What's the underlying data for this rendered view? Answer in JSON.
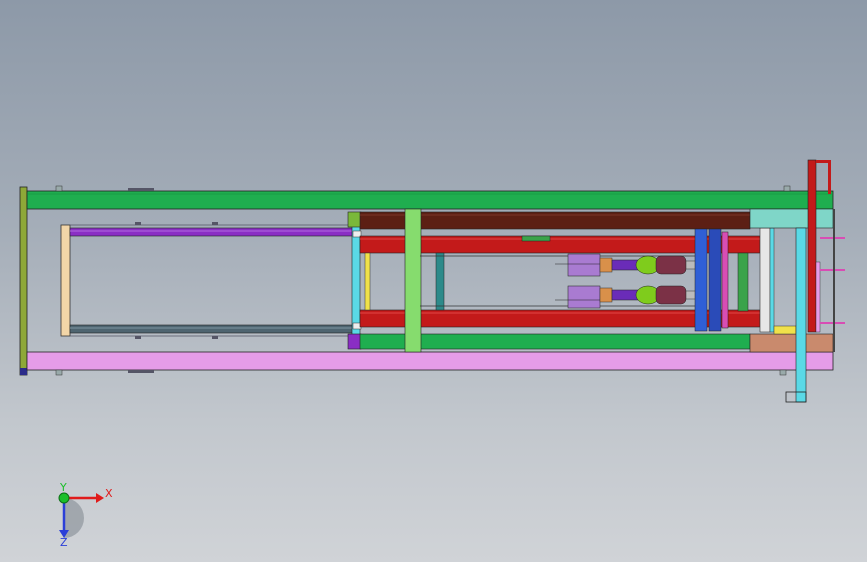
{
  "viewport": {
    "background_top": "#8d99a8",
    "background_bottom": "#d0d3d7"
  },
  "model": {
    "colors": {
      "frame_green": "#1fae4f",
      "frame_lavender": "#e59ce8",
      "end_plate_olive": "#8ea838",
      "brown_bar": "#5c1f14",
      "red_bar": "#c31a1a",
      "vertical_light_green": "#86dc6e",
      "purple_rod": "#8a2ec4",
      "slate_rod": "#4e6470",
      "cyan": "#5ad9e6",
      "teal_block": "#7fd6c8",
      "salmon_block": "#c98a6d",
      "blue_plate": "#2f5fd6",
      "cylinder_green": "#7fcc1c",
      "cylinder_maroon": "#7b3146",
      "yellow": "#f0e14a"
    }
  },
  "triad": {
    "x_label": "X",
    "y_label": "Y",
    "z_label": "Z",
    "x_color": "#e01b1b",
    "y_color": "#1bbf2a",
    "z_color": "#2b3fd8"
  }
}
